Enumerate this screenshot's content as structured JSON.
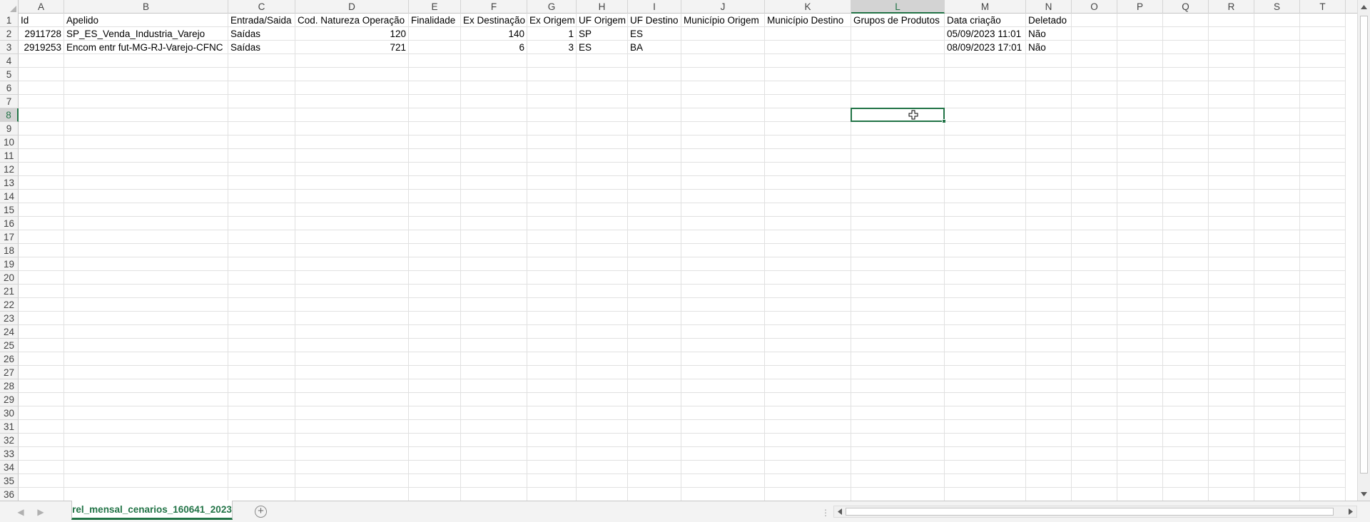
{
  "columns": [
    "A",
    "B",
    "C",
    "D",
    "E",
    "F",
    "G",
    "H",
    "I",
    "J",
    "K",
    "L",
    "M",
    "N",
    "O",
    "P",
    "Q",
    "R",
    "S",
    "T"
  ],
  "row_numbers": [
    "1",
    "2",
    "3",
    "4",
    "5",
    "6",
    "7",
    "8",
    "9",
    "10",
    "11",
    "12",
    "13",
    "14",
    "15",
    "16",
    "17",
    "18",
    "19",
    "20",
    "21",
    "22",
    "23",
    "24",
    "25",
    "26",
    "27",
    "28",
    "29",
    "30",
    "31",
    "32",
    "33",
    "34",
    "35",
    "36"
  ],
  "header_row": [
    "Id",
    "Apelido",
    "Entrada/Saida",
    "Cod. Natureza Operação",
    "Finalidade",
    "Ex Destinação",
    "Ex Origem",
    "UF Origem",
    "UF Destino",
    "Município Origem",
    "Município Destino",
    "Grupos de Produtos",
    "Data criação",
    "Deletado"
  ],
  "rows": [
    [
      "2911728",
      "SP_ES_Venda_Industria_Varejo",
      "Saídas",
      "120",
      "",
      "140",
      "1",
      "SP",
      "ES",
      "",
      "",
      "",
      "05/09/2023 11:01",
      "Não"
    ],
    [
      "2919253",
      "Encom entr fut-MG-RJ-Varejo-CFNC",
      "Saídas",
      "721",
      "",
      "6",
      "3",
      "ES",
      "BA",
      "",
      "",
      "",
      "08/09/2023 17:01",
      "Não"
    ]
  ],
  "selected_cell": {
    "column": "L",
    "row": "8"
  },
  "sheet_tab": {
    "label": "rel_mensal_cenarios_160641_2023"
  },
  "icons": {
    "select_all": "select-all-triangle-icon",
    "cursor": "cell-cursor-cross-icon",
    "add_sheet": "plus-icon",
    "colors": {
      "accent": "#217346",
      "header_bg": "#f3f3f3",
      "gridline": "#e1e1e1"
    }
  }
}
